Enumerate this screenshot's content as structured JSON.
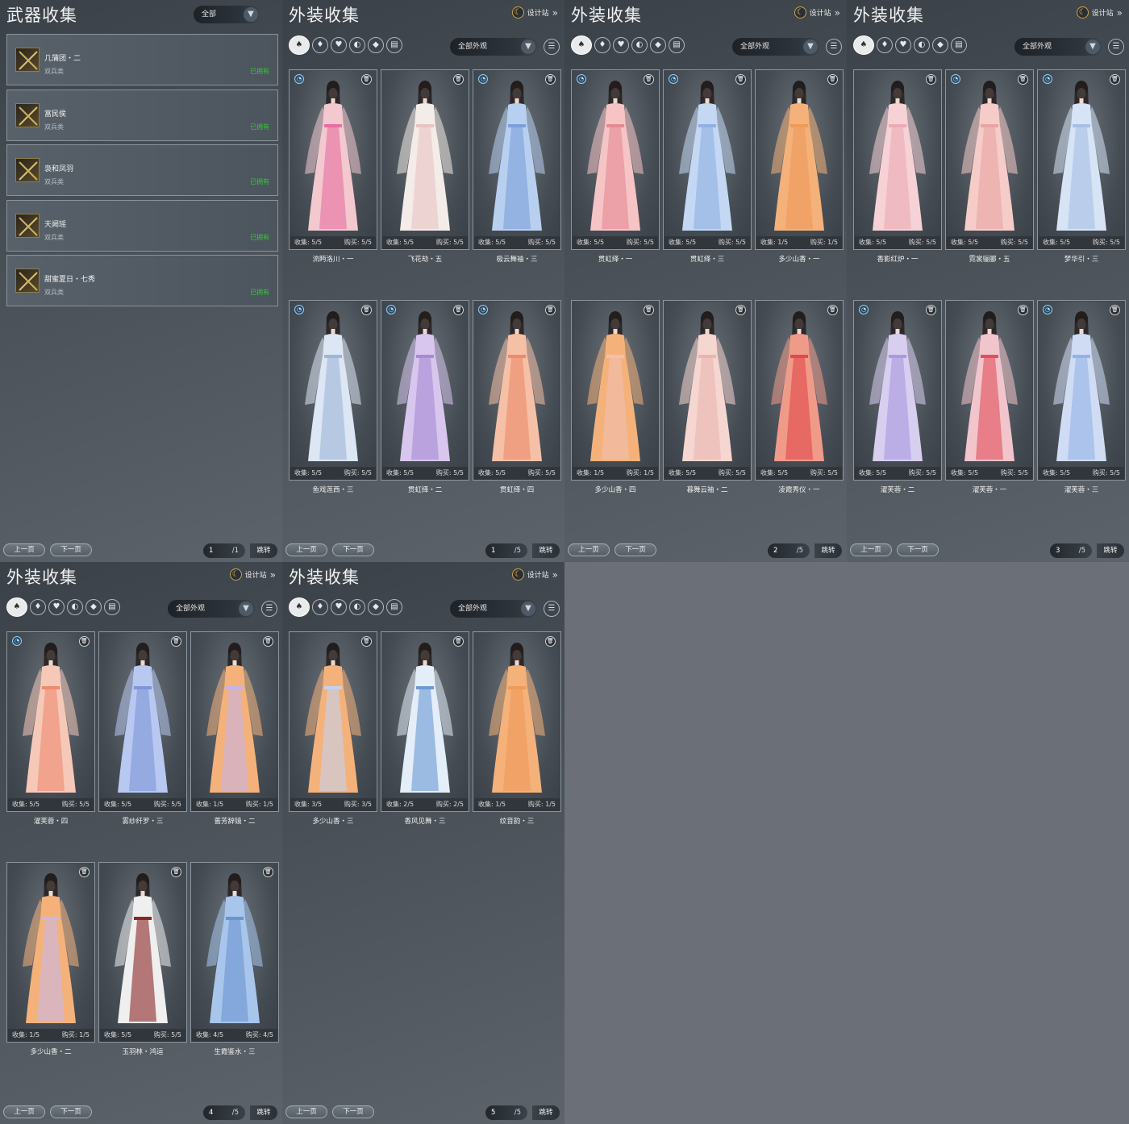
{
  "weapon_panel": {
    "title": "武器收集",
    "filter_value": "全部",
    "items": [
      {
        "name": "几蒲团・二",
        "type": "双兵类",
        "status": "已拥有"
      },
      {
        "name": "富民侯",
        "type": "双兵类",
        "status": "已拥有"
      },
      {
        "name": "袅和凤羽",
        "type": "双兵类",
        "status": "已拥有"
      },
      {
        "name": "天阙瑶",
        "type": "双兵类",
        "status": "已拥有"
      },
      {
        "name": "甜蜜夏日・七秀",
        "type": "双兵类",
        "status": "已拥有"
      }
    ],
    "pager": {
      "prev": "上一页",
      "next": "下一页",
      "page": "1",
      "total": "/1",
      "jump": "跳转"
    }
  },
  "outfit_common": {
    "title": "外装收集",
    "design_label": "设计站",
    "filter_value": "全部外观",
    "collect_label": "收集:",
    "buy_label": "购买:",
    "prev": "上一页",
    "next": "下一页",
    "jump": "跳转"
  },
  "outfit_pages": [
    {
      "page": "1",
      "total": "/5",
      "cards": [
        {
          "name": "流眄洛川・一",
          "collect": "5/5",
          "buy": "5/5",
          "badge": true,
          "colors": [
            "#f3c9cf",
            "#e86fa0"
          ]
        },
        {
          "name": "飞花劫・五",
          "collect": "5/5",
          "buy": "5/5",
          "badge": false,
          "colors": [
            "#f4ece8",
            "#e8c4c4"
          ]
        },
        {
          "name": "极云舞袖・三",
          "collect": "5/5",
          "buy": "5/5",
          "badge": true,
          "colors": [
            "#b8d0f0",
            "#7b9fd8"
          ]
        },
        {
          "name": "鱼戏莲西・三",
          "collect": "5/5",
          "buy": "5/5",
          "badge": true,
          "colors": [
            "#dce6f4",
            "#9fb6d6"
          ]
        },
        {
          "name": "贯虹绎・二",
          "collect": "5/5",
          "buy": "5/5",
          "badge": true,
          "colors": [
            "#d8c6ee",
            "#a68bd6"
          ]
        },
        {
          "name": "贯虹绎・四",
          "collect": "5/5",
          "buy": "5/5",
          "badge": true,
          "colors": [
            "#f6c0a6",
            "#ec8a6a"
          ]
        }
      ]
    },
    {
      "page": "2",
      "total": "/5",
      "cards": [
        {
          "name": "贯虹绎・一",
          "collect": "5/5",
          "buy": "5/5",
          "badge": true,
          "colors": [
            "#f6c4c4",
            "#e48a94"
          ]
        },
        {
          "name": "贯虹绎・三",
          "collect": "5/5",
          "buy": "5/5",
          "badge": true,
          "colors": [
            "#c4d8f4",
            "#8fb0e0"
          ]
        },
        {
          "name": "多少山香・一",
          "collect": "1/5",
          "buy": "1/5",
          "badge": false,
          "colors": [
            "#f4b27a",
            "#ee9a5a"
          ]
        },
        {
          "name": "多少山香・四",
          "collect": "1/5",
          "buy": "1/5",
          "badge": false,
          "colors": [
            "#f4b27a",
            "#f0c0b0"
          ]
        },
        {
          "name": "暮舞云袖・二",
          "collect": "5/5",
          "buy": "5/5",
          "badge": false,
          "colors": [
            "#f6d6d0",
            "#eab4b0"
          ]
        },
        {
          "name": "凌霞秀仪・一",
          "collect": "5/5",
          "buy": "5/5",
          "badge": false,
          "colors": [
            "#f09a8a",
            "#e04a4a"
          ]
        }
      ]
    },
    {
      "page": "3",
      "total": "/5",
      "cards": [
        {
          "name": "香影红炉・一",
          "collect": "5/5",
          "buy": "5/5",
          "badge": false,
          "colors": [
            "#f6d2d6",
            "#ecaab4"
          ]
        },
        {
          "name": "霓裳骊郦・五",
          "collect": "5/5",
          "buy": "5/5",
          "badge": true,
          "colors": [
            "#f6ccc8",
            "#e8a4a4"
          ]
        },
        {
          "name": "梦华引・三",
          "collect": "5/5",
          "buy": "5/5",
          "badge": true,
          "colors": [
            "#d6e4f6",
            "#a6c0e6"
          ]
        },
        {
          "name": "濯芙蓉・二",
          "collect": "5/5",
          "buy": "5/5",
          "badge": true,
          "colors": [
            "#d8cef0",
            "#a89ae0"
          ]
        },
        {
          "name": "濯芙蓉・一",
          "collect": "5/5",
          "buy": "5/5",
          "badge": false,
          "colors": [
            "#f2c4cc",
            "#e0505a"
          ]
        },
        {
          "name": "濯芙蓉・三",
          "collect": "5/5",
          "buy": "5/5",
          "badge": true,
          "colors": [
            "#cfdcf4",
            "#94b2e4"
          ]
        }
      ]
    },
    {
      "page": "4",
      "total": "/5",
      "cards": [
        {
          "name": "濯芙蓉・四",
          "collect": "5/5",
          "buy": "5/5",
          "badge": true,
          "colors": [
            "#f6c8b8",
            "#ee8a70"
          ]
        },
        {
          "name": "雾纱纤罗・三",
          "collect": "5/5",
          "buy": "5/5",
          "badge": false,
          "colors": [
            "#b8c8f0",
            "#7e96d8"
          ]
        },
        {
          "name": "蔷芳辞镜・二",
          "collect": "1/5",
          "buy": "1/5",
          "badge": false,
          "colors": [
            "#f4b27a",
            "#c8b4e4"
          ]
        },
        {
          "name": "多少山香・二",
          "collect": "1/5",
          "buy": "1/5",
          "badge": false,
          "colors": [
            "#f4b27a",
            "#c8b8e8"
          ]
        },
        {
          "name": "玉羽林・鸿运",
          "collect": "5/5",
          "buy": "5/5",
          "badge": false,
          "colors": [
            "#efefef",
            "#8a2626"
          ]
        },
        {
          "name": "生霞鉴水・三",
          "collect": "4/5",
          "buy": "4/5",
          "badge": false,
          "colors": [
            "#a8c6ec",
            "#6c94d0"
          ]
        }
      ]
    },
    {
      "page": "5",
      "total": "/5",
      "cards": [
        {
          "name": "多少山香・三",
          "collect": "3/5",
          "buy": "3/5",
          "badge": false,
          "colors": [
            "#f4b27a",
            "#c4d2ec"
          ]
        },
        {
          "name": "香风见舞・三",
          "collect": "2/5",
          "buy": "2/5",
          "badge": false,
          "colors": [
            "#e4eef8",
            "#6c9ad6"
          ]
        },
        {
          "name": "纹音韵・三",
          "collect": "1/5",
          "buy": "1/5",
          "badge": false,
          "colors": [
            "#f4b27a",
            "#ee9a5a"
          ]
        }
      ]
    }
  ]
}
